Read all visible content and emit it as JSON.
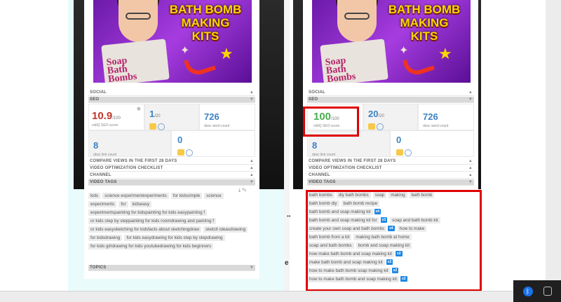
{
  "thumbnail": {
    "title_line1": "BATH BOMB",
    "title_line2": "MAKING",
    "title_line3": "KITS",
    "box_text_1": "Soap",
    "box_text_2": "Bath",
    "box_text_3": "Bombs"
  },
  "sections": {
    "social": "SOCIAL",
    "seo": "SEO",
    "compare": "COMPARE VIEWS IN THE FIRST 28 DAYS",
    "checklist": "VIDEO OPTIMIZATION CHECKLIST",
    "channel": "CHANNEL",
    "video_tags": "VIDEO TAGS",
    "topics": "TOPICS"
  },
  "left": {
    "seo_score": "10.9",
    "seo_score_max": "/100",
    "seo_score_label": "vidIQ SEO score",
    "tags_score": "1",
    "tags_score_max": "/20",
    "word_count": "726",
    "word_count_label": "desc word count",
    "link_count": "8",
    "link_count_label": "desc link count",
    "extra_count": "0",
    "tags": [
      "kids",
      "science experimentexperiments",
      "for kidssimple",
      "science",
      "experiments",
      "for",
      "kidseasy",
      "experimentspainting for kidspainting for kids easypainting f",
      "or kids step by steppainting for kids roomdrawing and painting f",
      "or kids easysketching for kidsfacts about sketchingdraw",
      "sketch ideasdrawing",
      "for kidsdrawing",
      "for kids easydrawing for kids step by stepdrawing",
      "for kids girldrawing for kids youtubedrawing for kids beginners"
    ]
  },
  "right": {
    "seo_score": "100",
    "seo_score_max": "/100",
    "seo_score_label": "vidIQ SEO score",
    "tags_score": "20",
    "tags_score_max": "/20",
    "word_count": "726",
    "word_count_label": "desc word count",
    "link_count": "8",
    "link_count_label": "desc link count",
    "extra_count": "0",
    "tag_rows": [
      [
        {
          "t": "bath bombs"
        },
        {
          "t": "diy bath bombs"
        },
        {
          "t": "soap"
        },
        {
          "t": "making"
        },
        {
          "t": "bath bomb"
        }
      ],
      [
        {
          "t": "bath bomb diy"
        },
        {
          "t": "bath bomb recipe"
        }
      ],
      [
        {
          "t": "bath bomb and soap making kit",
          "b": "x4"
        }
      ],
      [
        {
          "t": "bath bomb and soap making kit for",
          "b": "x3"
        },
        {
          "t": "soap and bath bomb kit"
        }
      ],
      [
        {
          "t": "create your own soap and bath bombs",
          "b": "x4"
        },
        {
          "t": "how to make"
        }
      ],
      [
        {
          "t": "bath bomb from a kit"
        },
        {
          "t": "making bath bomb at home"
        }
      ],
      [
        {
          "t": "soap and bath bombs"
        },
        {
          "t": "bomb and soap making kit"
        }
      ],
      [
        {
          "t": "how make bath bomb and soap making kit",
          "b": "x2"
        }
      ],
      [
        {
          "t": "make bath bomb and soap making kit",
          "b": "x2"
        }
      ],
      [
        {
          "t": "how to make bath bomb soap making kit",
          "b": "x2"
        }
      ],
      [
        {
          "t": "how to make bath bomb and soap making kit",
          "b": "x2"
        }
      ]
    ]
  },
  "misc": {
    "dots": "••",
    "e_char": "e",
    "arrow_up": "▲",
    "arrow_down": "▼",
    "bluetooth": "ᛒ"
  },
  "colors": {
    "highlight": "#e00000",
    "score_low": "#c0392b",
    "score_high": "#4caf50",
    "accent": "#3b82c4",
    "badge": "#1e88e5"
  }
}
